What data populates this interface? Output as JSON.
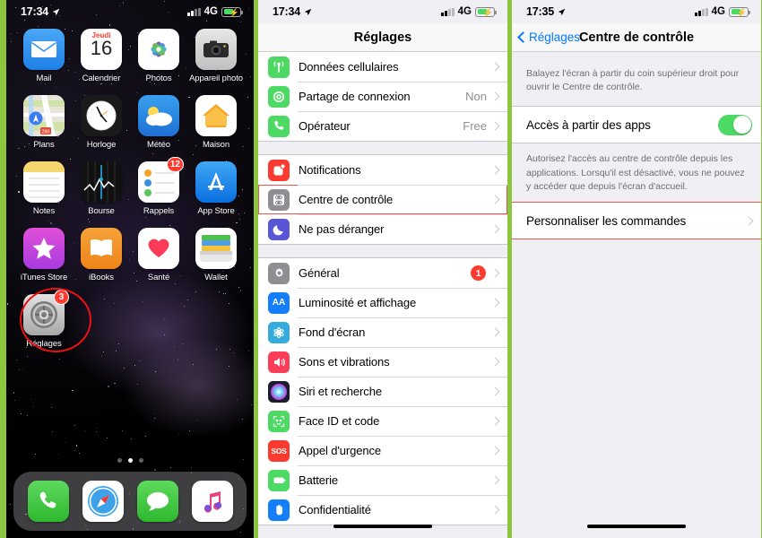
{
  "theme": {
    "accent_green": "#8cc63e",
    "ios_blue": "#007aff",
    "ios_red": "#ff3b30",
    "highlight_red": "#ef5350",
    "toggle_green": "#4cd964"
  },
  "panels": {
    "home": {
      "name": "iphone-home-screen",
      "status": {
        "time": "17:34",
        "network": "4G",
        "battery_charging": true
      },
      "apps": [
        {
          "label": "Mail",
          "icon": "mail-icon",
          "badge": null
        },
        {
          "label": "Calendrier",
          "icon": "calendar-icon",
          "badge": null,
          "day_name": "Jeudi",
          "day_number": "16"
        },
        {
          "label": "Photos",
          "icon": "photos-icon",
          "badge": null
        },
        {
          "label": "Appareil photo",
          "icon": "camera-icon",
          "badge": null
        },
        {
          "label": "Plans",
          "icon": "maps-icon",
          "badge": null
        },
        {
          "label": "Horloge",
          "icon": "clock-icon",
          "badge": null
        },
        {
          "label": "Météo",
          "icon": "weather-icon",
          "badge": null
        },
        {
          "label": "Maison",
          "icon": "home-icon",
          "badge": null
        },
        {
          "label": "Notes",
          "icon": "notes-icon",
          "badge": null
        },
        {
          "label": "Bourse",
          "icon": "stocks-icon",
          "badge": null
        },
        {
          "label": "Rappels",
          "icon": "reminders-icon",
          "badge": "12"
        },
        {
          "label": "App Store",
          "icon": "appstore-icon",
          "badge": null
        },
        {
          "label": "iTunes Store",
          "icon": "itunes-store-icon",
          "badge": null
        },
        {
          "label": "iBooks",
          "icon": "ibooks-icon",
          "badge": null
        },
        {
          "label": "Santé",
          "icon": "health-icon",
          "badge": null
        },
        {
          "label": "Wallet",
          "icon": "wallet-icon",
          "badge": null
        },
        {
          "label": "Réglages",
          "icon": "settings-gear-icon",
          "badge": "3",
          "highlighted": true
        }
      ],
      "page_dots": {
        "count": 3,
        "active_index": 1
      },
      "dock": [
        {
          "label": "Téléphone",
          "icon": "phone-icon"
        },
        {
          "label": "Safari",
          "icon": "safari-compass-icon"
        },
        {
          "label": "Messages",
          "icon": "messages-bubble-icon"
        },
        {
          "label": "Musique",
          "icon": "music-note-icon"
        }
      ]
    },
    "settings": {
      "name": "ios-settings-list",
      "status": {
        "time": "17:34",
        "network": "4G",
        "battery_charging": true
      },
      "nav_title": "Réglages",
      "groups": [
        {
          "rows": [
            {
              "label": "Données cellulaires",
              "icon": "cellular-antenna-icon",
              "value": "",
              "badge": null,
              "highlighted": false
            },
            {
              "label": "Partage de connexion",
              "icon": "hotspot-link-icon",
              "value": "Non",
              "badge": null,
              "highlighted": false
            },
            {
              "label": "Opérateur",
              "icon": "carrier-phone-icon",
              "value": "Free",
              "badge": null,
              "highlighted": false
            }
          ]
        },
        {
          "rows": [
            {
              "label": "Notifications",
              "icon": "notifications-icon",
              "value": "",
              "badge": null,
              "highlighted": false
            },
            {
              "label": "Centre de contrôle",
              "icon": "control-center-icon",
              "value": "",
              "badge": null,
              "highlighted": true
            },
            {
              "label": "Ne pas déranger",
              "icon": "do-not-disturb-moon-icon",
              "value": "",
              "badge": null,
              "highlighted": false
            }
          ]
        },
        {
          "rows": [
            {
              "label": "Général",
              "icon": "general-gear-icon",
              "value": "",
              "badge": "1",
              "highlighted": false
            },
            {
              "label": "Luminosité et affichage",
              "icon": "display-brightness-icon",
              "value": "",
              "badge": null,
              "highlighted": false
            },
            {
              "label": "Fond d'écran",
              "icon": "wallpaper-flower-icon",
              "value": "",
              "badge": null,
              "highlighted": false
            },
            {
              "label": "Sons et vibrations",
              "icon": "sounds-speaker-icon",
              "value": "",
              "badge": null,
              "highlighted": false
            },
            {
              "label": "Siri et recherche",
              "icon": "siri-icon",
              "value": "",
              "badge": null,
              "highlighted": false
            },
            {
              "label": "Face ID et code",
              "icon": "face-id-icon",
              "value": "",
              "badge": null,
              "highlighted": false
            },
            {
              "label": "Appel d'urgence",
              "icon": "sos-icon",
              "value": "",
              "badge": null,
              "highlighted": false
            },
            {
              "label": "Batterie",
              "icon": "battery-icon",
              "value": "",
              "badge": null,
              "highlighted": false
            },
            {
              "label": "Confidentialité",
              "icon": "privacy-hand-icon",
              "value": "",
              "badge": null,
              "highlighted": false
            }
          ]
        }
      ]
    },
    "control": {
      "name": "ios-control-center-settings",
      "status": {
        "time": "17:35",
        "network": "4G",
        "battery_charging": true
      },
      "back_label": "Réglages",
      "nav_title": "Centre de contrôle",
      "intro_text": "Balayez l'écran à partir du coin supérieur droit pour ouvrir le Centre de contrôle.",
      "toggle_row": {
        "label": "Accès à partir des apps",
        "state": "on"
      },
      "toggle_footnote": "Autorisez l'accès au centre de contrôle depuis les applications. Lorsqu'il est désactivé, vous ne pouvez y accéder que depuis l'écran d'accueil.",
      "customize_row": {
        "label": "Personnaliser les commandes",
        "highlighted": true
      }
    }
  }
}
